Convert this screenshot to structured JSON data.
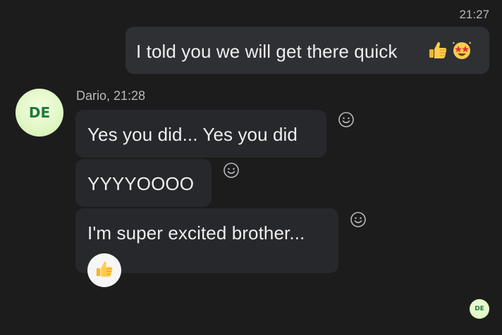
{
  "chat": {
    "outgoing": {
      "time": "21:27",
      "text": "I told you we will get there quick",
      "emojis": [
        "thumbs-up-icon",
        "star-struck-icon"
      ]
    },
    "incoming": {
      "sender_line": "Dario, 21:28",
      "avatar_initials": "DE",
      "messages": [
        {
          "text": "Yes you did... Yes you did"
        },
        {
          "text": "YYYYOOOO"
        },
        {
          "text": "I'm super excited brother...",
          "reaction": "thumbs-up-icon"
        }
      ]
    },
    "read_receipt_initials": "DE"
  },
  "colors": {
    "background": "#1c1c1d",
    "outgoing_bubble": "#2f3034",
    "incoming_bubble": "#27282b",
    "avatar_text": "#1f7a3c"
  }
}
